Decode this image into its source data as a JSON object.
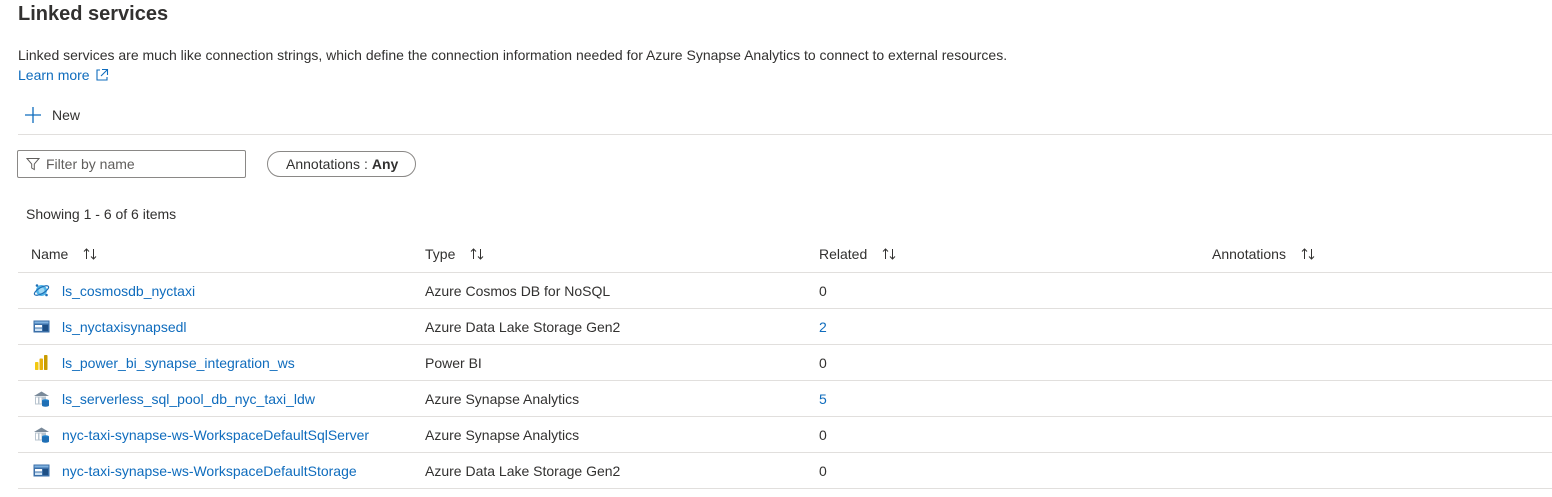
{
  "page": {
    "title": "Linked services",
    "description": "Linked services are much like connection strings, which define the connection information needed for Azure Synapse Analytics to connect to external resources.",
    "learn_more": "Learn more"
  },
  "toolbar": {
    "new_label": "New"
  },
  "filters": {
    "name_placeholder": "Filter by name",
    "name_value": "",
    "annotations_label": "Annotations",
    "annotations_sep": ":",
    "annotations_value": "Any"
  },
  "status": {
    "showing": "Showing 1 - 6 of 6 items"
  },
  "table": {
    "columns": [
      {
        "label": "Name"
      },
      {
        "label": "Type"
      },
      {
        "label": "Related"
      },
      {
        "label": "Annotations"
      }
    ],
    "rows": [
      {
        "icon": "cosmos-db-icon",
        "name": "ls_cosmosdb_nyctaxi",
        "type": "Azure Cosmos DB for NoSQL",
        "related": "0",
        "annotations": ""
      },
      {
        "icon": "data-lake-storage-icon",
        "name": "ls_nyctaxisynapsedl",
        "type": "Azure Data Lake Storage Gen2",
        "related": "2",
        "annotations": ""
      },
      {
        "icon": "power-bi-icon",
        "name": "ls_power_bi_synapse_integration_ws",
        "type": "Power BI",
        "related": "0",
        "annotations": ""
      },
      {
        "icon": "synapse-analytics-icon",
        "name": "ls_serverless_sql_pool_db_nyc_taxi_ldw",
        "type": "Azure Synapse Analytics",
        "related": "5",
        "annotations": ""
      },
      {
        "icon": "synapse-analytics-icon",
        "name": "nyc-taxi-synapse-ws-WorkspaceDefaultSqlServer",
        "type": "Azure Synapse Analytics",
        "related": "0",
        "annotations": ""
      },
      {
        "icon": "data-lake-storage-icon",
        "name": "nyc-taxi-synapse-ws-WorkspaceDefaultStorage",
        "type": "Azure Data Lake Storage Gen2",
        "related": "0",
        "annotations": ""
      }
    ]
  },
  "colors": {
    "link": "#0f6cbd",
    "text": "#323130",
    "border": "#e1dfdd"
  }
}
